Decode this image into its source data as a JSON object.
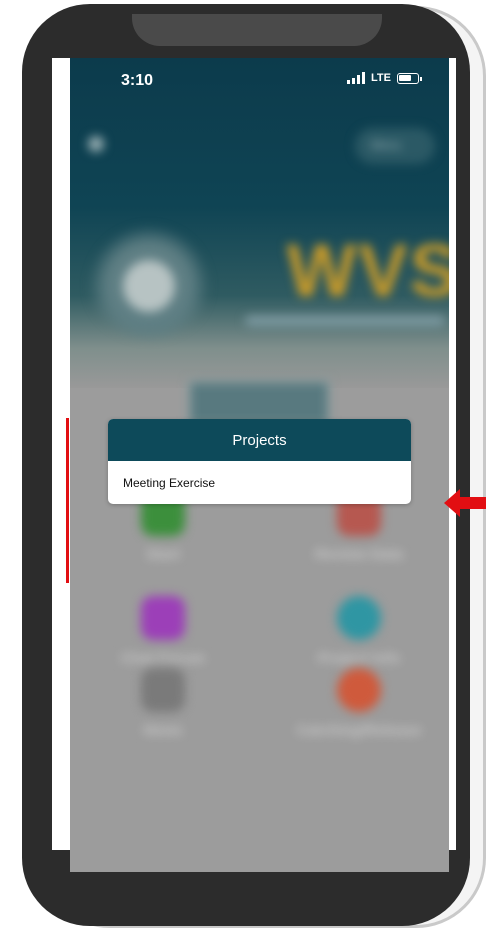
{
  "status_bar": {
    "time": "3:10",
    "network": "LTE"
  },
  "background_app": {
    "menu_label": "Menu",
    "brand_short": "WVS",
    "tiles": [
      {
        "label": "Start",
        "color": "#3c8f3c"
      },
      {
        "label": "Review Data",
        "color": "#b65850"
      },
      {
        "label": "Chat Forum",
        "color": "#9c3fb8"
      },
      {
        "label": "Project Info",
        "color": "#2f96a3"
      },
      {
        "label": "News",
        "color": "#7a7a7a"
      },
      {
        "label": "Catching/Release",
        "color": "#cf5a3c"
      }
    ]
  },
  "modal": {
    "title": "Projects",
    "items": [
      {
        "label": "Meeting Exercise"
      }
    ]
  },
  "annotations": {
    "highlight_color": "#e20e12"
  }
}
